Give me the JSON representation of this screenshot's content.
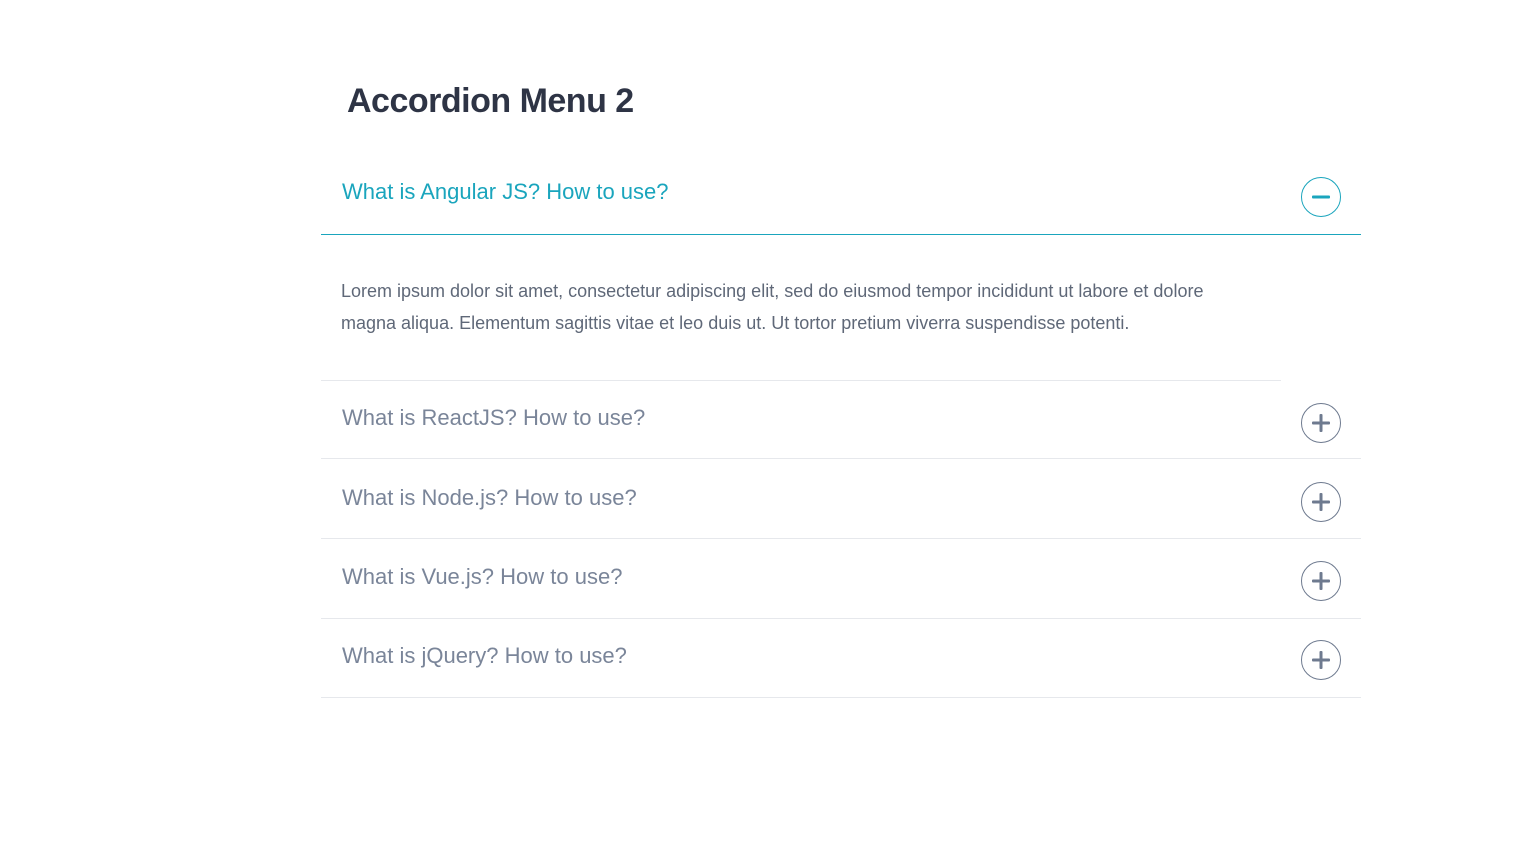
{
  "page": {
    "title": "Accordion Menu 2"
  },
  "colors": {
    "accent": "#1aa5bd",
    "heading": "#2e3445",
    "question": "#7a8599",
    "body_text": "#5f6878",
    "divider": "#e6e8ec"
  },
  "accordion": {
    "items": [
      {
        "question": "What is Angular JS? How to use?",
        "answer": "Lorem ipsum dolor sit amet, consectetur adipiscing elit, sed do eiusmod tempor incididunt ut labore et dolore magna aliqua. Elementum sagittis vitae et leo duis ut. Ut tortor pretium viverra suspendisse potenti.",
        "expanded": true,
        "icon": "minus-circle-icon"
      },
      {
        "question": "What is ReactJS? How to use?",
        "expanded": false,
        "icon": "plus-circle-icon"
      },
      {
        "question": "What is Node.js? How to use?",
        "expanded": false,
        "icon": "plus-circle-icon"
      },
      {
        "question": "What is Vue.js? How to use?",
        "expanded": false,
        "icon": "plus-circle-icon"
      },
      {
        "question": "What is jQuery? How to use?",
        "expanded": false,
        "icon": "plus-circle-icon"
      }
    ]
  }
}
